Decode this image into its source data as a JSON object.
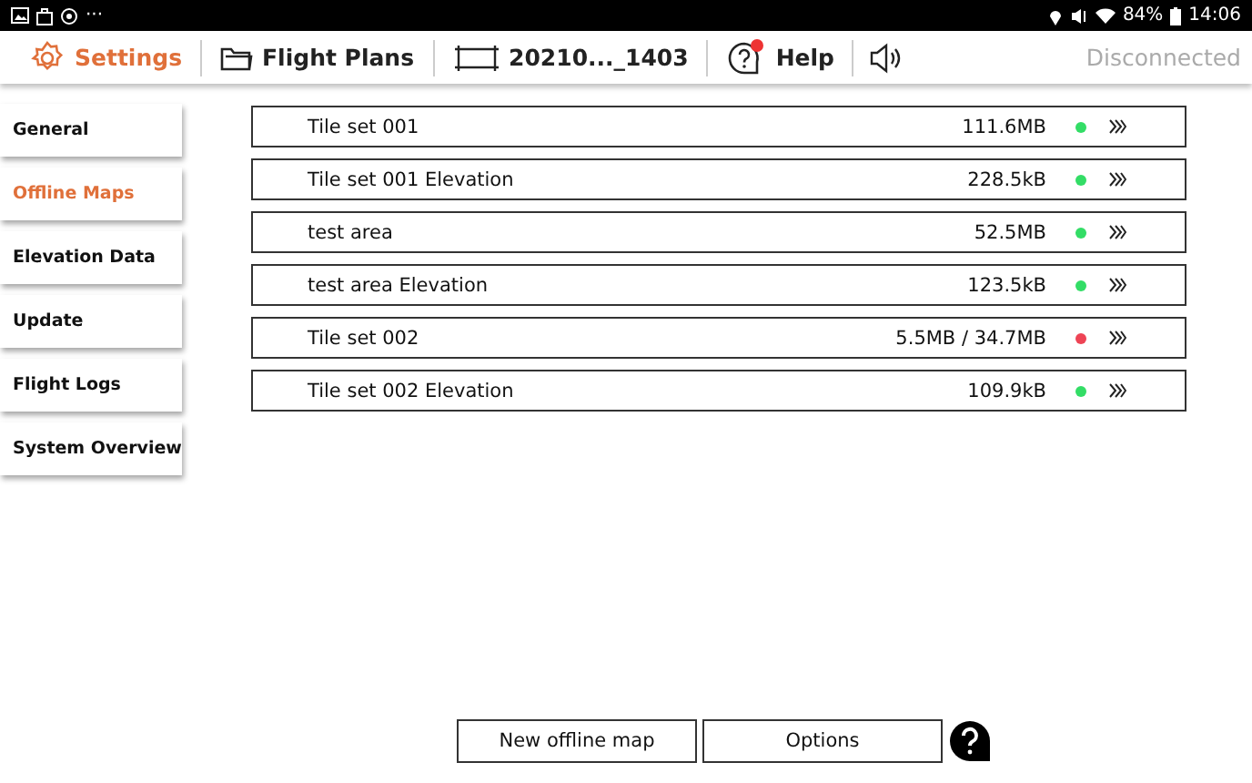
{
  "status_bar": {
    "overflow": "···",
    "battery": "84%",
    "time": "14:06"
  },
  "toolbar": {
    "items": [
      {
        "label": "Settings",
        "kind": "settings",
        "selected": true
      },
      {
        "label": "Flight Plans",
        "kind": "folder",
        "selected": false
      },
      {
        "label": "20210..._1403",
        "kind": "plan",
        "selected": false
      },
      {
        "label": "Help",
        "kind": "help",
        "selected": false
      }
    ],
    "connection": "Disconnected"
  },
  "sidebar": {
    "items": [
      {
        "label": "General",
        "selected": false
      },
      {
        "label": "Offline Maps",
        "selected": true
      },
      {
        "label": "Elevation Data",
        "selected": false
      },
      {
        "label": "Update",
        "selected": false
      },
      {
        "label": "Flight Logs",
        "selected": false
      },
      {
        "label": "System Overview",
        "selected": false
      }
    ]
  },
  "maps": [
    {
      "name": "Tile set 001",
      "size": "111.6MB",
      "color": "#33dd66"
    },
    {
      "name": "Tile set 001 Elevation",
      "size": "228.5kB",
      "color": "#33dd66"
    },
    {
      "name": "test area",
      "size": "52.5MB",
      "color": "#33dd66"
    },
    {
      "name": "test area Elevation",
      "size": "123.5kB",
      "color": "#33dd66"
    },
    {
      "name": "Tile set 002",
      "size": "5.5MB / 34.7MB",
      "color": "#ee4455"
    },
    {
      "name": "Tile set 002 Elevation",
      "size": "109.9kB",
      "color": "#33dd66"
    }
  ],
  "buttons": [
    "New offline map",
    "Options"
  ]
}
